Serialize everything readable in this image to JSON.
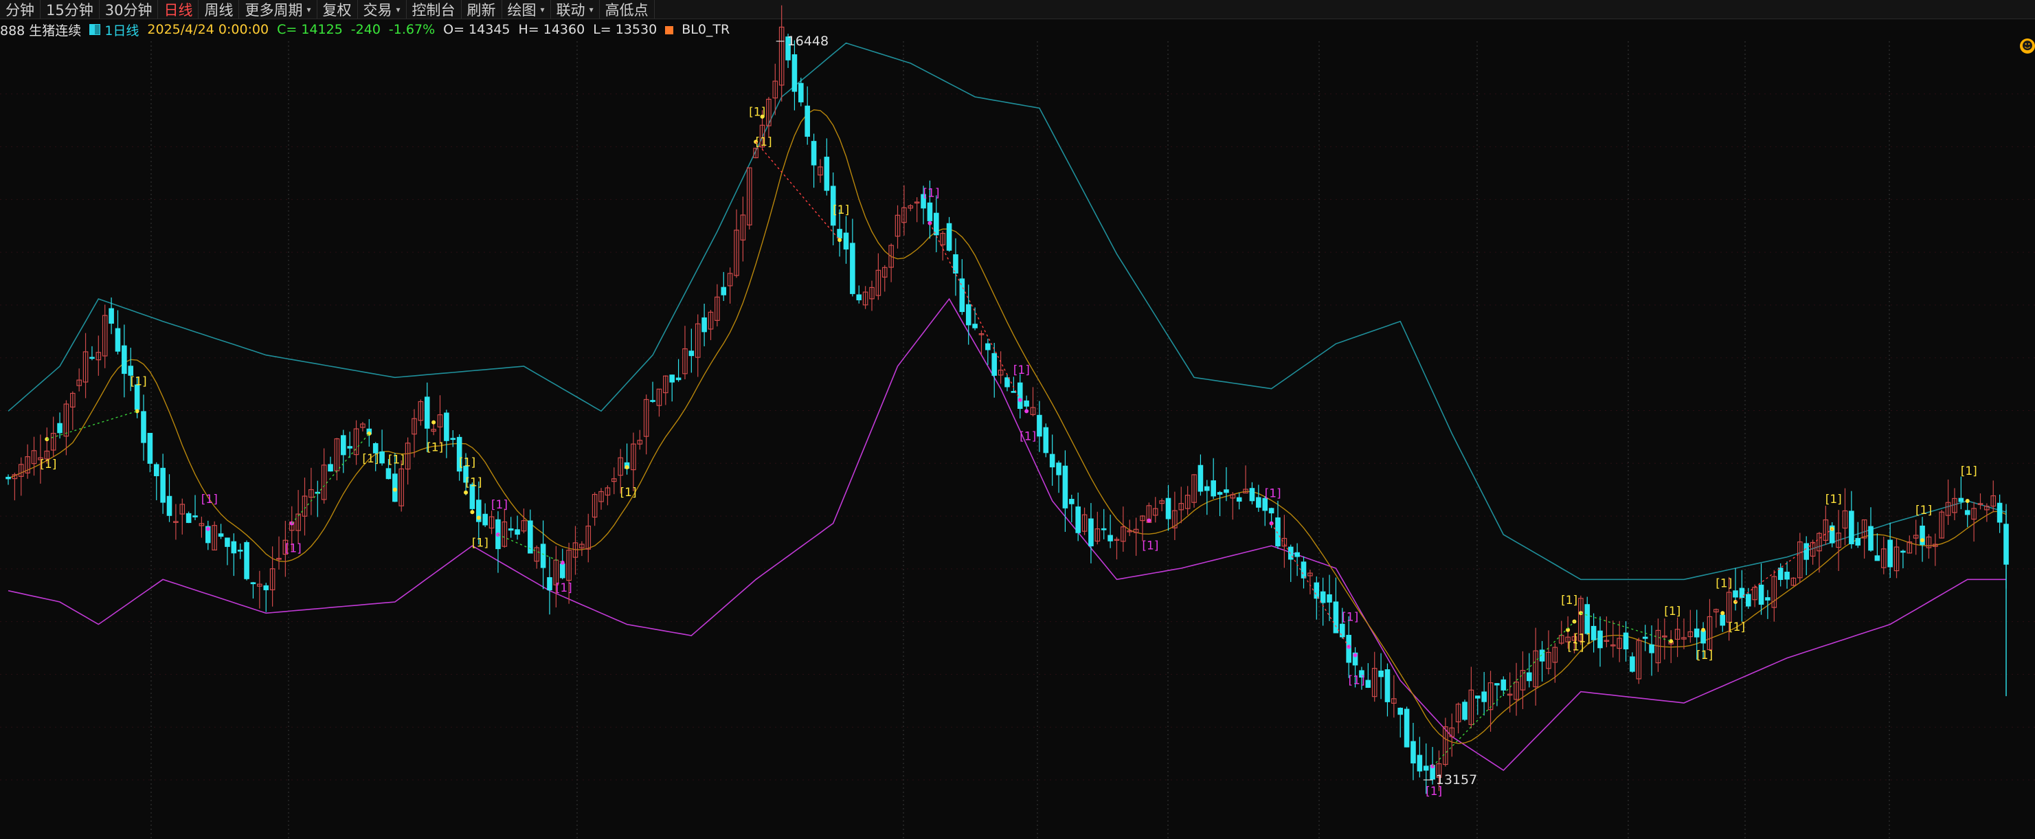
{
  "toolbar": {
    "items": [
      {
        "label": "分钟",
        "active": false,
        "dropdown": false
      },
      {
        "label": "15分钟",
        "active": false,
        "dropdown": false
      },
      {
        "label": "30分钟",
        "active": false,
        "dropdown": false
      },
      {
        "label": "日线",
        "active": true,
        "dropdown": false
      },
      {
        "label": "周线",
        "active": false,
        "dropdown": false
      },
      {
        "label": "更多周期",
        "active": false,
        "dropdown": true
      },
      {
        "label": "复权",
        "active": false,
        "dropdown": false
      },
      {
        "label": "交易",
        "active": false,
        "dropdown": true
      },
      {
        "label": "控制台",
        "active": false,
        "dropdown": false
      },
      {
        "label": "刷新",
        "active": false,
        "dropdown": false
      },
      {
        "label": "绘图",
        "active": false,
        "dropdown": true
      },
      {
        "label": "联动",
        "active": false,
        "dropdown": true
      },
      {
        "label": "高低点",
        "active": false,
        "dropdown": false
      }
    ],
    "active_color": "#ff4a4a"
  },
  "info": {
    "symbol": "888 生猪连续",
    "period": "1日线",
    "datetime": "2025/4/24 0:00:00",
    "close": "C= 14125",
    "change": "-240",
    "change_pct": "-1.67%",
    "open": "O= 14345",
    "high": "H= 14360",
    "low": "L= 13530",
    "indicator": "BL0_TR"
  },
  "labels": {
    "high_marker": "16448",
    "low_marker": "13157",
    "signal_up": "[1]",
    "signal_down": "[1]"
  },
  "colors": {
    "up": "#cf4a4a",
    "down": "#2ee6f0",
    "upper_band": "#1f8f9a",
    "lower_band": "#c13ad6",
    "mid": "#b8860b",
    "signal_yellow": "#ffe23a",
    "signal_magenta": "#e63ae6"
  },
  "chart_data": {
    "type": "candlestick",
    "ylim": [
      13157,
      16448
    ],
    "max": 16448,
    "min": 13157,
    "keypoints": [
      [
        0,
        14500
      ],
      [
        4,
        14600
      ],
      [
        8,
        14750
      ],
      [
        12,
        15050
      ],
      [
        16,
        15200
      ],
      [
        20,
        14800
      ],
      [
        24,
        14400
      ],
      [
        28,
        14350
      ],
      [
        32,
        14250
      ],
      [
        36,
        14150
      ],
      [
        40,
        14000
      ],
      [
        44,
        14300
      ],
      [
        48,
        14500
      ],
      [
        52,
        14650
      ],
      [
        56,
        14700
      ],
      [
        60,
        14450
      ],
      [
        64,
        14800
      ],
      [
        68,
        14700
      ],
      [
        72,
        14350
      ],
      [
        76,
        14250
      ],
      [
        80,
        14300
      ],
      [
        84,
        14050
      ],
      [
        88,
        14200
      ],
      [
        92,
        14500
      ],
      [
        96,
        14550
      ],
      [
        100,
        14900
      ],
      [
        104,
        14950
      ],
      [
        108,
        15200
      ],
      [
        112,
        15450
      ],
      [
        116,
        16000
      ],
      [
        120,
        16448
      ],
      [
        124,
        16000
      ],
      [
        128,
        15650
      ],
      [
        132,
        15300
      ],
      [
        136,
        15500
      ],
      [
        140,
        15750
      ],
      [
        144,
        15600
      ],
      [
        148,
        15300
      ],
      [
        152,
        15050
      ],
      [
        156,
        14900
      ],
      [
        160,
        14700
      ],
      [
        164,
        14400
      ],
      [
        168,
        14250
      ],
      [
        172,
        14200
      ],
      [
        176,
        14300
      ],
      [
        180,
        14350
      ],
      [
        184,
        14500
      ],
      [
        188,
        14400
      ],
      [
        192,
        14450
      ],
      [
        196,
        14300
      ],
      [
        200,
        14100
      ],
      [
        204,
        13950
      ],
      [
        208,
        13750
      ],
      [
        212,
        13600
      ],
      [
        216,
        13400
      ],
      [
        220,
        13157
      ],
      [
        224,
        13400
      ],
      [
        228,
        13550
      ],
      [
        232,
        13500
      ],
      [
        236,
        13650
      ],
      [
        240,
        13750
      ],
      [
        244,
        13900
      ],
      [
        248,
        13750
      ],
      [
        252,
        13700
      ],
      [
        256,
        13800
      ],
      [
        260,
        13750
      ],
      [
        264,
        13850
      ],
      [
        268,
        13950
      ],
      [
        272,
        14000
      ],
      [
        276,
        14100
      ],
      [
        280,
        14200
      ],
      [
        284,
        14300
      ],
      [
        288,
        14250
      ],
      [
        292,
        14150
      ],
      [
        296,
        14200
      ],
      [
        300,
        14300
      ],
      [
        304,
        14400
      ],
      [
        308,
        14400
      ],
      [
        310,
        14125
      ]
    ],
    "upper_band_kp": [
      [
        0,
        14800
      ],
      [
        8,
        15000
      ],
      [
        14,
        15300
      ],
      [
        24,
        15200
      ],
      [
        40,
        15050
      ],
      [
        60,
        14950
      ],
      [
        80,
        15000
      ],
      [
        92,
        14800
      ],
      [
        100,
        15050
      ],
      [
        110,
        15600
      ],
      [
        120,
        16200
      ],
      [
        130,
        16440
      ],
      [
        140,
        16350
      ],
      [
        150,
        16200
      ],
      [
        160,
        16150
      ],
      [
        172,
        15500
      ],
      [
        184,
        14950
      ],
      [
        196,
        14900
      ],
      [
        206,
        15100
      ],
      [
        216,
        15200
      ],
      [
        224,
        14700
      ],
      [
        232,
        14250
      ],
      [
        244,
        14050
      ],
      [
        260,
        14050
      ],
      [
        276,
        14150
      ],
      [
        292,
        14300
      ],
      [
        304,
        14400
      ],
      [
        310,
        14350
      ]
    ],
    "lower_band_kp": [
      [
        0,
        14000
      ],
      [
        8,
        13950
      ],
      [
        14,
        13850
      ],
      [
        24,
        14050
      ],
      [
        40,
        13900
      ],
      [
        60,
        13950
      ],
      [
        72,
        14200
      ],
      [
        84,
        14000
      ],
      [
        96,
        13850
      ],
      [
        106,
        13800
      ],
      [
        116,
        14050
      ],
      [
        128,
        14300
      ],
      [
        138,
        15000
      ],
      [
        146,
        15300
      ],
      [
        154,
        14900
      ],
      [
        162,
        14400
      ],
      [
        172,
        14050
      ],
      [
        182,
        14100
      ],
      [
        196,
        14200
      ],
      [
        206,
        14100
      ],
      [
        216,
        13600
      ],
      [
        224,
        13350
      ],
      [
        232,
        13200
      ],
      [
        244,
        13550
      ],
      [
        260,
        13500
      ],
      [
        276,
        13700
      ],
      [
        292,
        13850
      ],
      [
        304,
        14050
      ],
      [
        310,
        14050
      ]
    ]
  }
}
